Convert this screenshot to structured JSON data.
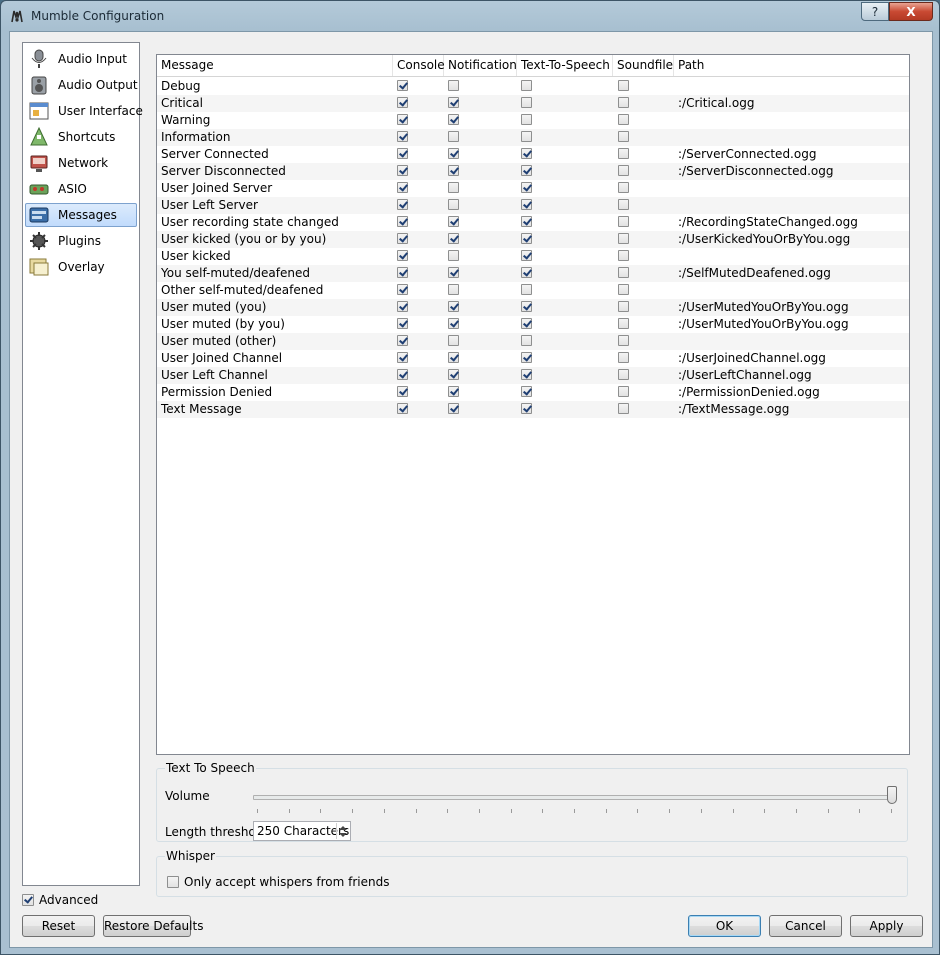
{
  "window": {
    "title": "Mumble Configuration",
    "help": "?",
    "close": "X"
  },
  "sidebar": {
    "items": [
      {
        "label": "Audio Input",
        "icon": "microphone-icon"
      },
      {
        "label": "Audio Output",
        "icon": "speaker-icon"
      },
      {
        "label": "User Interface",
        "icon": "window-icon"
      },
      {
        "label": "Shortcuts",
        "icon": "keyboard-icon"
      },
      {
        "label": "Network",
        "icon": "network-icon"
      },
      {
        "label": "ASIO",
        "icon": "asio-icon"
      },
      {
        "label": "Messages",
        "icon": "messages-icon",
        "selected": true
      },
      {
        "label": "Plugins",
        "icon": "plugin-icon"
      },
      {
        "label": "Overlay",
        "icon": "overlay-icon"
      }
    ]
  },
  "table": {
    "headers": [
      "Message",
      "Console",
      "Notification",
      "Text-To-Speech",
      "Soundfile",
      "Path"
    ],
    "rows": [
      {
        "message": "Debug",
        "console": true,
        "notification": false,
        "tts": false,
        "soundfile": false,
        "path": ""
      },
      {
        "message": "Critical",
        "console": true,
        "notification": true,
        "tts": false,
        "soundfile": false,
        "path": ":/Critical.ogg"
      },
      {
        "message": "Warning",
        "console": true,
        "notification": true,
        "tts": false,
        "soundfile": false,
        "path": ""
      },
      {
        "message": "Information",
        "console": true,
        "notification": false,
        "tts": false,
        "soundfile": false,
        "path": ""
      },
      {
        "message": "Server Connected",
        "console": true,
        "notification": true,
        "tts": true,
        "soundfile": false,
        "path": ":/ServerConnected.ogg"
      },
      {
        "message": "Server Disconnected",
        "console": true,
        "notification": true,
        "tts": true,
        "soundfile": false,
        "path": ":/ServerDisconnected.ogg"
      },
      {
        "message": "User Joined Server",
        "console": true,
        "notification": false,
        "tts": true,
        "soundfile": false,
        "path": ""
      },
      {
        "message": "User Left Server",
        "console": true,
        "notification": false,
        "tts": true,
        "soundfile": false,
        "path": ""
      },
      {
        "message": "User recording state changed",
        "console": true,
        "notification": true,
        "tts": true,
        "soundfile": false,
        "path": ":/RecordingStateChanged.ogg"
      },
      {
        "message": "User kicked (you or by you)",
        "console": true,
        "notification": true,
        "tts": true,
        "soundfile": false,
        "path": ":/UserKickedYouOrByYou.ogg"
      },
      {
        "message": "User kicked",
        "console": true,
        "notification": false,
        "tts": true,
        "soundfile": false,
        "path": ""
      },
      {
        "message": "You self-muted/deafened",
        "console": true,
        "notification": true,
        "tts": true,
        "soundfile": false,
        "path": ":/SelfMutedDeafened.ogg"
      },
      {
        "message": "Other self-muted/deafened",
        "console": true,
        "notification": false,
        "tts": false,
        "soundfile": false,
        "path": ""
      },
      {
        "message": "User muted (you)",
        "console": true,
        "notification": true,
        "tts": true,
        "soundfile": false,
        "path": ":/UserMutedYouOrByYou.ogg"
      },
      {
        "message": "User muted (by you)",
        "console": true,
        "notification": true,
        "tts": true,
        "soundfile": false,
        "path": ":/UserMutedYouOrByYou.ogg"
      },
      {
        "message": "User muted (other)",
        "console": true,
        "notification": false,
        "tts": false,
        "soundfile": false,
        "path": ""
      },
      {
        "message": "User Joined Channel",
        "console": true,
        "notification": true,
        "tts": true,
        "soundfile": false,
        "path": ":/UserJoinedChannel.ogg"
      },
      {
        "message": "User Left Channel",
        "console": true,
        "notification": true,
        "tts": true,
        "soundfile": false,
        "path": ":/UserLeftChannel.ogg"
      },
      {
        "message": "Permission Denied",
        "console": true,
        "notification": true,
        "tts": true,
        "soundfile": false,
        "path": ":/PermissionDenied.ogg"
      },
      {
        "message": "Text Message",
        "console": true,
        "notification": true,
        "tts": true,
        "soundfile": false,
        "path": ":/TextMessage.ogg"
      }
    ]
  },
  "tts": {
    "title": "Text To Speech",
    "volume_label": "Volume",
    "volume_percent": 100,
    "threshold_label": "Length threshold",
    "threshold_value": "250 Characters"
  },
  "whisper": {
    "title": "Whisper",
    "friends_only_label": "Only accept whispers from friends",
    "friends_only": false
  },
  "footer": {
    "advanced_label": "Advanced",
    "advanced": true,
    "reset": "Reset",
    "restore_defaults": "Restore Defaults",
    "ok": "OK",
    "cancel": "Cancel",
    "apply": "Apply"
  }
}
